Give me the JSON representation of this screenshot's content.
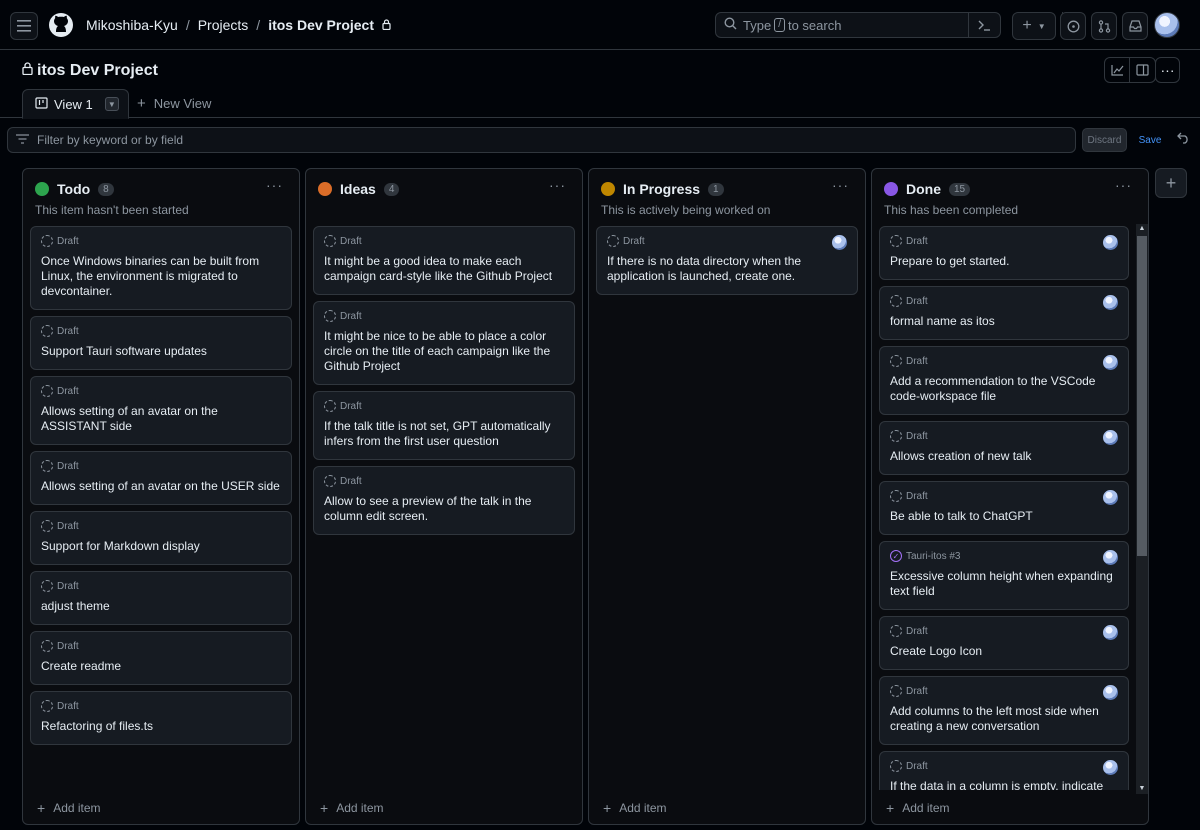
{
  "header": {
    "owner": "Mikoshiba-Kyu",
    "projects": "Projects",
    "project": "itos Dev Project",
    "search_placeholder_pre": "Type",
    "search_key": "/",
    "search_placeholder_post": "to search"
  },
  "project": {
    "title": "itos Dev Project",
    "tab_active": "View 1",
    "tab_new": "New View",
    "filter_placeholder": "Filter by keyword or by field",
    "discard": "Discard",
    "save": "Save"
  },
  "columns": [
    {
      "name": "Todo",
      "count": "8",
      "description": "This item hasn't been started",
      "color": "#2da44e",
      "add": "Add item",
      "cards": [
        {
          "label": "Draft",
          "title": "Once Windows binaries can be built from Linux, the environment is migrated to devcontainer."
        },
        {
          "label": "Draft",
          "title": "Support Tauri software updates"
        },
        {
          "label": "Draft",
          "title": "Allows setting of an avatar on the ASSISTANT side"
        },
        {
          "label": "Draft",
          "title": "Allows setting of an avatar on the USER side"
        },
        {
          "label": "Draft",
          "title": "Support for Markdown display"
        },
        {
          "label": "Draft",
          "title": "adjust theme"
        },
        {
          "label": "Draft",
          "title": "Create readme"
        },
        {
          "label": "Draft",
          "title": "Refactoring of files.ts"
        }
      ]
    },
    {
      "name": "Ideas",
      "count": "4",
      "description": "",
      "color": "#db6d28",
      "add": "Add item",
      "cards": [
        {
          "label": "Draft",
          "title": "It might be a good idea to make each campaign card-style like the Github Project"
        },
        {
          "label": "Draft",
          "title": "It might be nice to be able to place a color circle on the title of each campaign like the Github Project"
        },
        {
          "label": "Draft",
          "title": "If the talk title is not set, GPT automatically infers from the first user question"
        },
        {
          "label": "Draft",
          "title": "Allow to see a preview of the talk in the column edit screen."
        }
      ]
    },
    {
      "name": "In Progress",
      "count": "1",
      "description": "This is actively being worked on",
      "color": "#bf8700",
      "add": "Add item",
      "cards": [
        {
          "label": "Draft",
          "title": "If there is no data directory when the application is launched, create one.",
          "avatar": true
        }
      ]
    },
    {
      "name": "Done",
      "count": "15",
      "description": "This has been completed",
      "color": "#8957e5",
      "add": "Add item",
      "cards": [
        {
          "label": "Draft",
          "title": "Prepare to get started.",
          "avatar": true
        },
        {
          "label": "Draft",
          "title": "formal name as itos",
          "avatar": true
        },
        {
          "label": "Draft",
          "title": "Add a recommendation to the VSCode code-workspace file",
          "avatar": true
        },
        {
          "label": "Draft",
          "title": "Allows creation of new talk",
          "avatar": true
        },
        {
          "label": "Draft",
          "title": "Be able to talk to ChatGPT",
          "avatar": true
        },
        {
          "label": "Tauri-itos #3",
          "title": "Excessive column height when expanding text field",
          "avatar": true,
          "issue": true
        },
        {
          "label": "Draft",
          "title": "Create Logo Icon",
          "avatar": true
        },
        {
          "label": "Draft",
          "title": "Add columns to the left most side when creating a new conversation",
          "avatar": true
        },
        {
          "label": "Draft",
          "title": "If the data in a column is empty, indicate this",
          "avatar": true
        }
      ]
    }
  ]
}
